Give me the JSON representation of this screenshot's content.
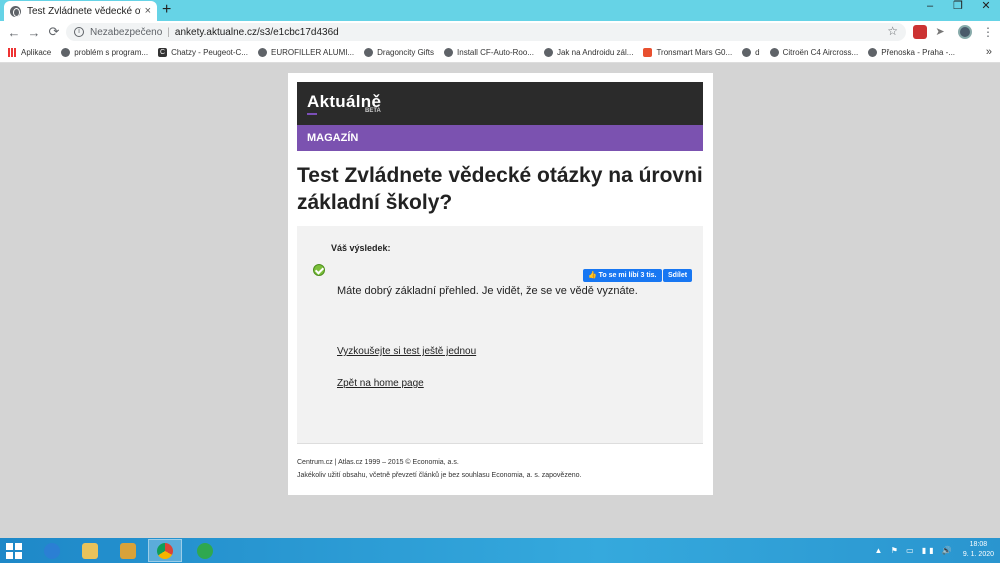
{
  "browser": {
    "tab_title": "Test Zvládnete vědecké otázky n",
    "tab_close": "×",
    "new_tab": "+",
    "window_controls": [
      "–",
      "❐",
      "✕"
    ],
    "nav": {
      "back": "←",
      "forward": "→",
      "reload": "⟳"
    },
    "security_label": "Nezabezpečeno",
    "url": "ankety.aktualne.cz/s3/e1cbc17d436d",
    "bookmark_star": "☆",
    "menu": "⋮"
  },
  "bookmarks": [
    {
      "label": "Aplikace",
      "icon": "apps-icon"
    },
    {
      "label": "problém s program...",
      "icon": "globe-icon"
    },
    {
      "label": "Chatzy - Peugeot-C...",
      "icon": "chatzy-icon"
    },
    {
      "label": "EUROFILLER ALUMI...",
      "icon": "globe-icon"
    },
    {
      "label": "Dragoncity Gifts",
      "icon": "globe-icon"
    },
    {
      "label": "Install CF-Auto-Roo...",
      "icon": "globe-icon"
    },
    {
      "label": "Jak na Androidu zál...",
      "icon": "globe-icon"
    },
    {
      "label": "Tronsmart Mars G0...",
      "icon": "aliexpress-icon"
    },
    {
      "label": "d",
      "icon": "globe-icon"
    },
    {
      "label": "Citroën C4 Aircross...",
      "icon": "globe-icon"
    },
    {
      "label": "Přenoska - Praha -...",
      "icon": "globe-icon"
    }
  ],
  "bookmarks_more": "»",
  "page": {
    "logo": "Aktuálně",
    "beta": "BETA",
    "section": "MAGAZÍN",
    "headline": "Test Zvládnete vědecké otázky na úrovni základní školy?",
    "result_label": "Váš výsledek:",
    "fb_like": "👍 To se mi líbí 3 tis.",
    "fb_share": "Sdílet",
    "result_text": "Máte dobrý základní přehled. Je vidět, že se ve vědě vyznáte.",
    "retry_link": "Vyzkoušejte si test ještě jednou",
    "home_link": "Zpět na home page",
    "footer_line1": "Centrum.cz | Atlas.cz 1999 – 2015 © Economia, a.s.",
    "footer_line2": "Jakékoliv užití obsahu, včetně převzetí článků je bez souhlasu Economia, a. s. zapovězeno."
  },
  "taskbar": {
    "tray_icons": "▲ ⚑ ▭ ▮▮ 🔊",
    "time": "18:08",
    "date": "9. 1. 2020"
  },
  "colors": {
    "tabstrip": "#66d3e6",
    "brand_bar": "#2b2b2b",
    "section_bar": "#7b52b0",
    "facebook": "#1877f2",
    "check": "#7bbf3a"
  }
}
